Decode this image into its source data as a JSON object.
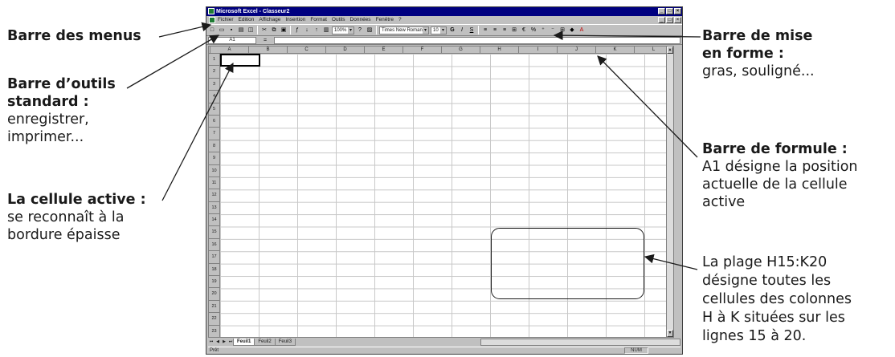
{
  "annotations": {
    "menu_bar": {
      "title": "Barre des menus"
    },
    "standard_toolbar": {
      "title_line1": "Barre d’outils",
      "title_line2": "standard :",
      "desc_line1": "enregistrer,",
      "desc_line2": "imprimer..."
    },
    "active_cell": {
      "title": "La cellule active :",
      "desc_line1": "se reconnaît à la",
      "desc_line2": "bordure épaisse"
    },
    "format_bar": {
      "title_line1": "Barre de mise",
      "title_line2": "en forme :",
      "desc": "gras, souligné..."
    },
    "formula_bar": {
      "title": "Barre de formule :",
      "desc_line1": "A1 désigne la position",
      "desc_line2": "actuelle de la cellule",
      "desc_line3": "active"
    },
    "range": {
      "line1": "La plage H15:K20",
      "line2": "désigne toutes les",
      "line3": "cellules des colonnes",
      "line4": "H à K situées sur les",
      "line5": "lignes 15 à 20."
    }
  },
  "excel": {
    "title": "Microsoft Excel - Classeur2",
    "window_buttons": [
      "_",
      "□",
      "×"
    ],
    "menus": [
      "Fichier",
      "Edition",
      "Affichage",
      "Insertion",
      "Format",
      "Outils",
      "Données",
      "Fenêtre",
      "?"
    ],
    "toolbar": {
      "zoom": "100%",
      "font": "Times New Roman",
      "font_size": "10"
    },
    "name_box": "A1",
    "equals_sign": "=",
    "columns": [
      "A",
      "B",
      "C",
      "D",
      "E",
      "F",
      "G",
      "H",
      "I",
      "J",
      "K",
      "L"
    ],
    "rows": [
      "1",
      "2",
      "3",
      "4",
      "5",
      "6",
      "7",
      "8",
      "9",
      "10",
      "11",
      "12",
      "13",
      "14",
      "15",
      "16",
      "17",
      "18",
      "19",
      "20",
      "21",
      "22",
      "23"
    ],
    "sheet_tabs": [
      "Feuil1",
      "Feuil2",
      "Feuil3"
    ],
    "status": "Prêt",
    "num_indicator": "NUM"
  }
}
